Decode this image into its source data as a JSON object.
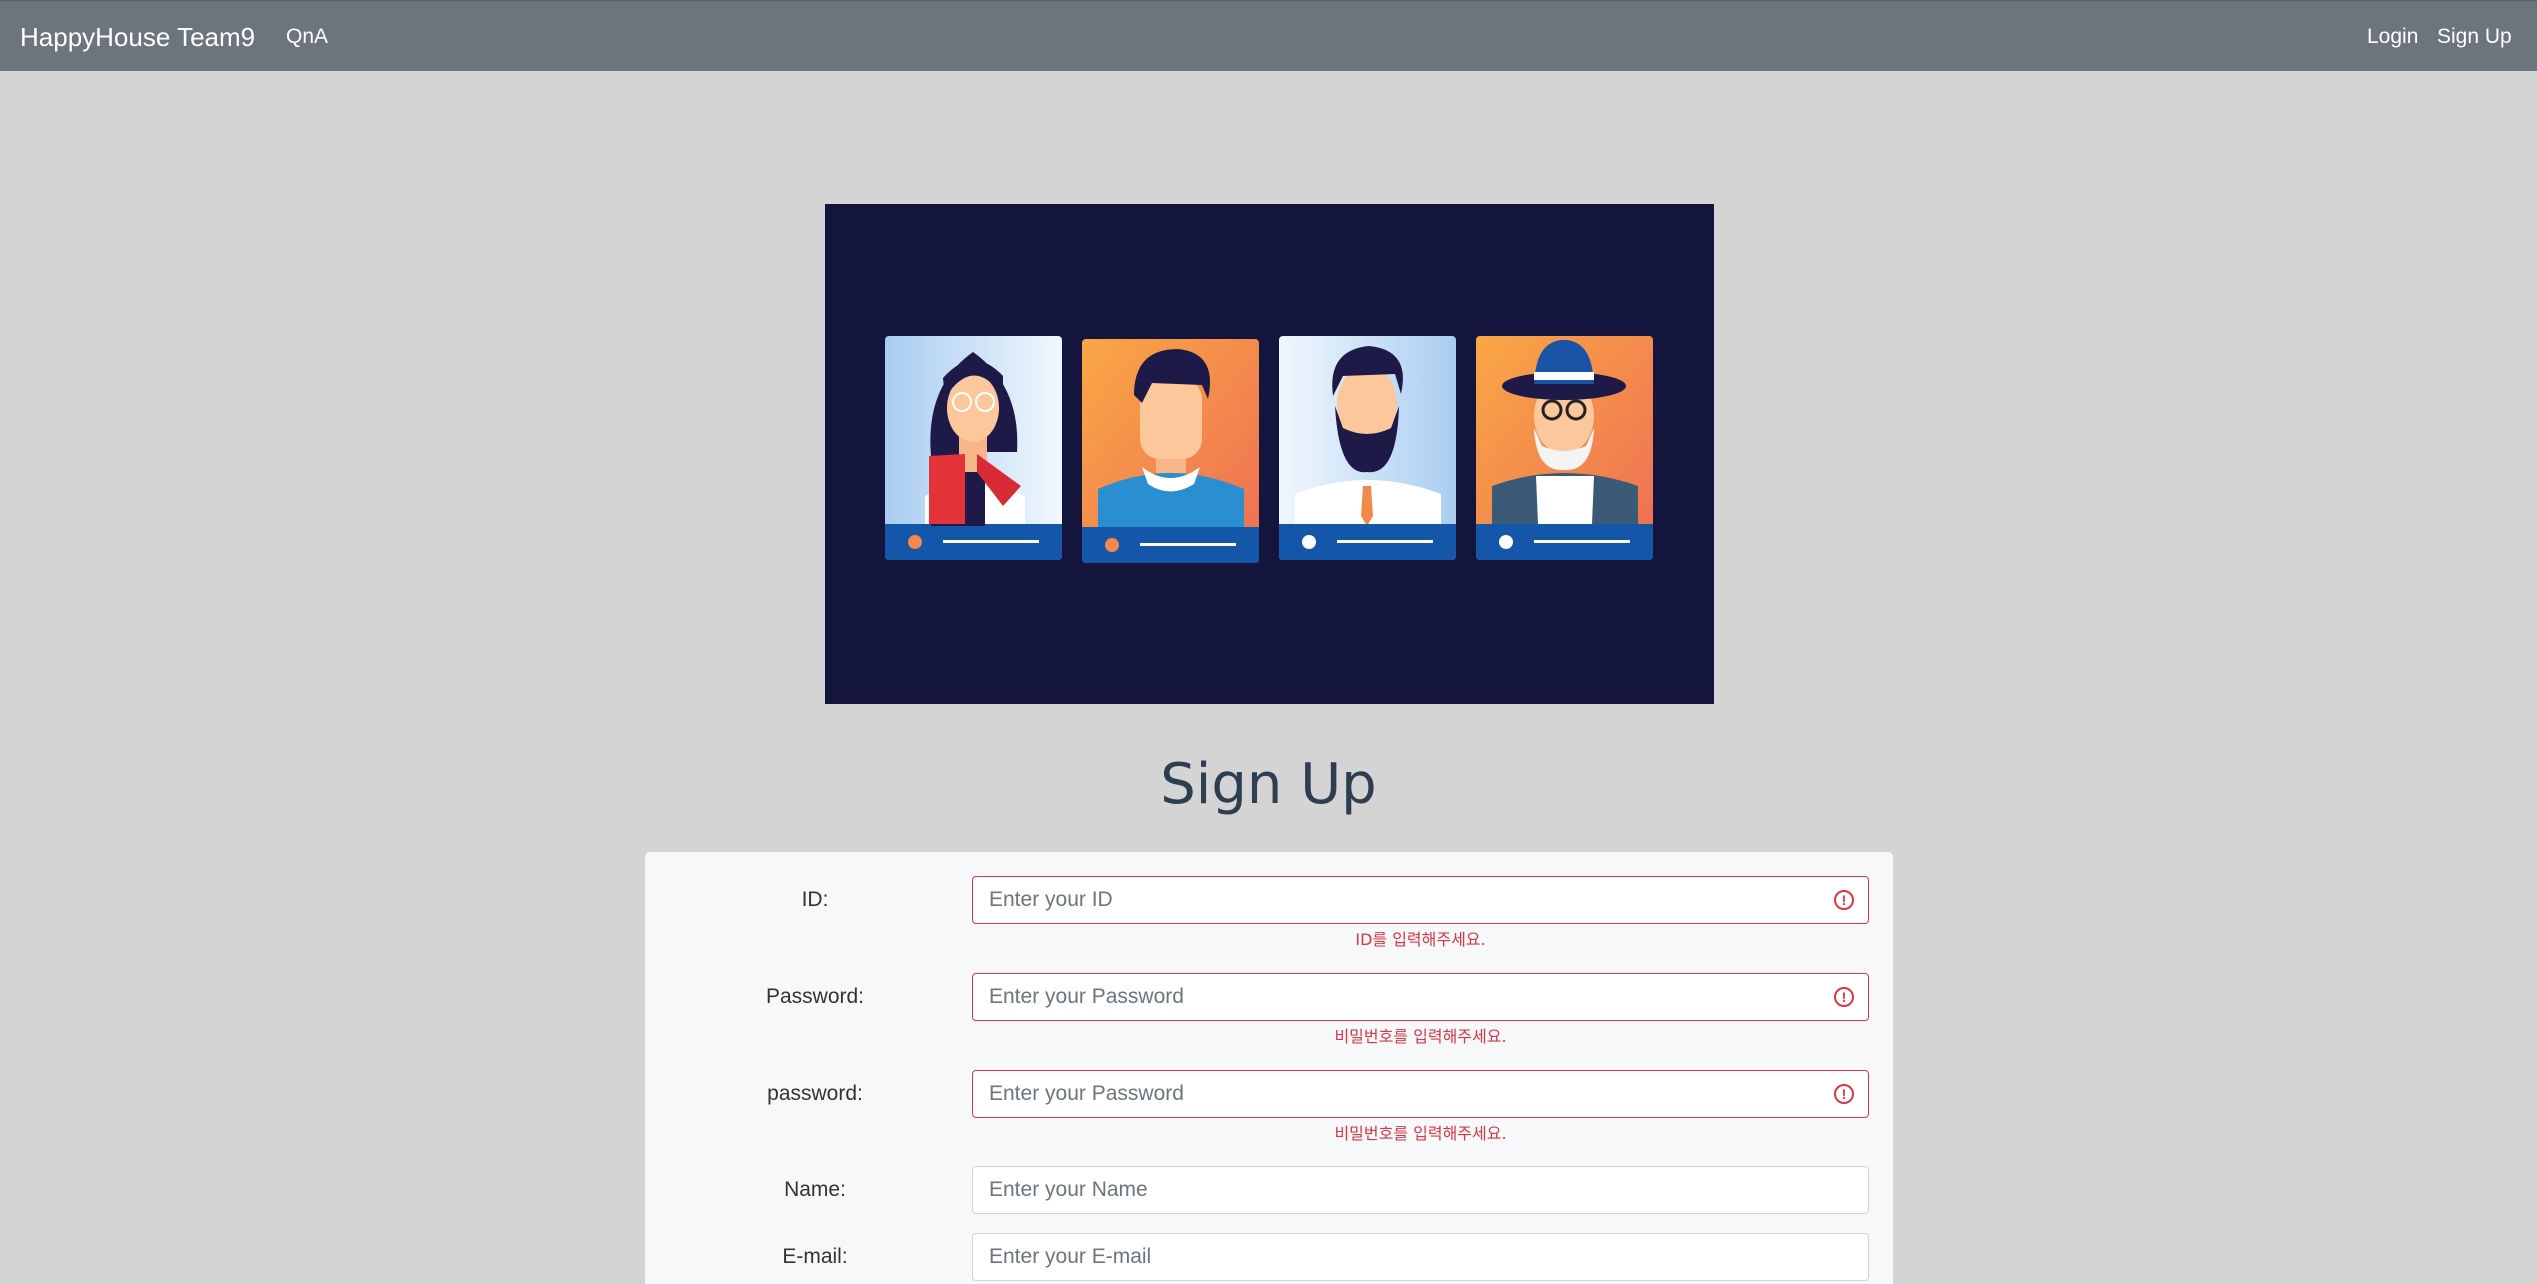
{
  "navbar": {
    "brand": "HappyHouse Team9",
    "links": {
      "qna": "QnA",
      "login": "Login",
      "signup": "Sign Up"
    },
    "background": "#6c757d"
  },
  "hero": {
    "background": "#13153d",
    "icons": [
      "woman-avatar-icon",
      "man-avatar-icon",
      "bearded-man-avatar-icon",
      "old-man-hat-avatar-icon"
    ]
  },
  "page_title": "Sign Up",
  "form": {
    "fields": [
      {
        "label": "ID:",
        "placeholder": "Enter your ID",
        "value": "",
        "invalid": true,
        "feedback": "ID를 입력해주세요."
      },
      {
        "label": "Password:",
        "placeholder": "Enter your Password",
        "value": "",
        "invalid": true,
        "feedback": "비밀번호를 입력해주세요."
      },
      {
        "label": "password:",
        "placeholder": "Enter your Password",
        "value": "",
        "invalid": true,
        "feedback": "비밀번호를 입력해주세요."
      },
      {
        "label": "Name:",
        "placeholder": "Enter your Name",
        "value": "",
        "invalid": false
      },
      {
        "label": "E-mail:",
        "placeholder": "Enter your E-mail",
        "value": "",
        "invalid": false
      }
    ],
    "error_color": "#dc3545",
    "error_icon": "!"
  }
}
